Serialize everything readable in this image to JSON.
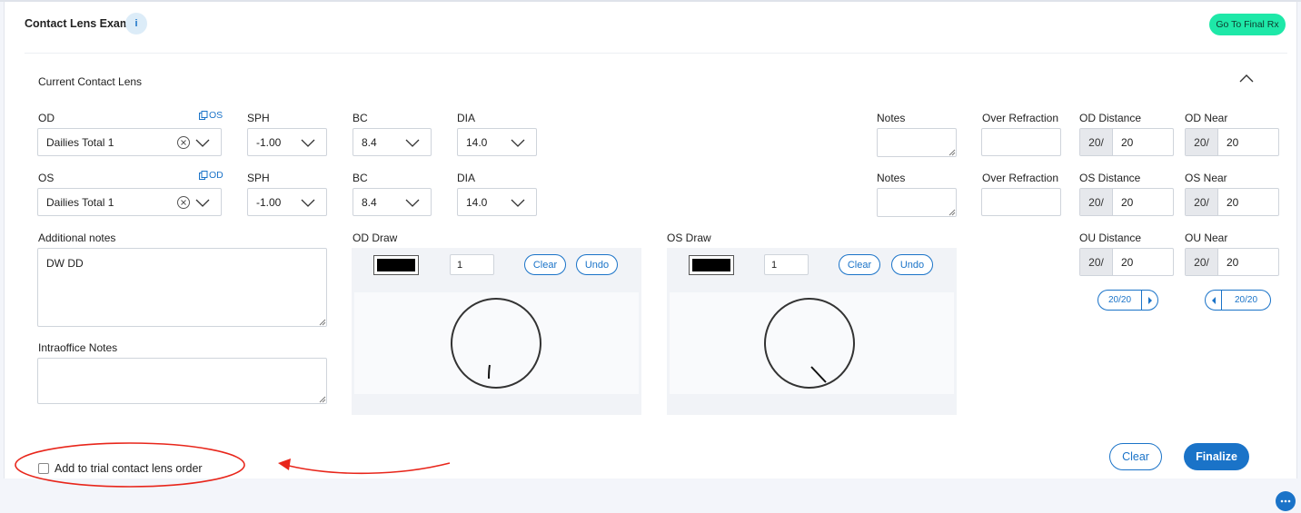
{
  "header": {
    "title": "Contact Lens Exam",
    "info_icon_glyph": "i",
    "go_final_rx_label": "Go To Final Rx"
  },
  "section": {
    "title": "Current Contact Lens"
  },
  "od_row": {
    "eye_label": "OD",
    "copy_label": "OS",
    "lens_value": "Dailies Total 1",
    "sph_label": "SPH",
    "sph_value": "-1.00",
    "bc_label": "BC",
    "bc_value": "8.4",
    "dia_label": "DIA",
    "dia_value": "14.0",
    "notes_label": "Notes",
    "notes_value": "",
    "over_refraction_label": "Over Refraction",
    "over_refraction_value": "",
    "distance_label": "OD Distance",
    "distance_prefix": "20/",
    "distance_value": "20",
    "near_label": "OD Near",
    "near_prefix": "20/",
    "near_value": "20"
  },
  "os_row": {
    "eye_label": "OS",
    "copy_label": "OD",
    "lens_value": "Dailies Total 1",
    "sph_label": "SPH",
    "sph_value": "-1.00",
    "bc_label": "BC",
    "bc_value": "8.4",
    "dia_label": "DIA",
    "dia_value": "14.0",
    "notes_label": "Notes",
    "notes_value": "",
    "over_refraction_label": "Over Refraction",
    "over_refraction_value": "",
    "distance_label": "OS Distance",
    "distance_prefix": "20/",
    "distance_value": "20",
    "near_label": "OS Near",
    "near_prefix": "20/",
    "near_value": "20"
  },
  "ou_row": {
    "distance_label": "OU Distance",
    "distance_prefix": "20/",
    "distance_value": "20",
    "near_label": "OU Near",
    "near_prefix": "20/",
    "near_value": "20",
    "distance_stepper_value": "20/20",
    "near_stepper_value": "20/20"
  },
  "notes": {
    "additional_label": "Additional notes",
    "additional_value": "DW DD",
    "intraoffice_label": "Intraoffice Notes",
    "intraoffice_value": ""
  },
  "od_draw": {
    "label": "OD Draw",
    "brush_size": "1",
    "clear_label": "Clear",
    "undo_label": "Undo",
    "color": "#000000"
  },
  "os_draw": {
    "label": "OS Draw",
    "brush_size": "1",
    "clear_label": "Clear",
    "undo_label": "Undo",
    "color": "#000000"
  },
  "footer": {
    "trial_order_label": "Add to trial contact lens order",
    "trial_order_checked": false,
    "clear_label": "Clear",
    "finalize_label": "Finalize"
  },
  "annotation": {
    "highlight_color": "#e8261b"
  },
  "colors": {
    "accent": "#1a73c8",
    "final_rx_bg": "#1ee8a8"
  },
  "icons": {
    "info": "info-icon",
    "copy": "copy-icon",
    "clear": "clear-circle-icon",
    "chevron": "chevron-down-icon",
    "collapse": "chevron-up-icon",
    "more": "more-dots-icon"
  }
}
